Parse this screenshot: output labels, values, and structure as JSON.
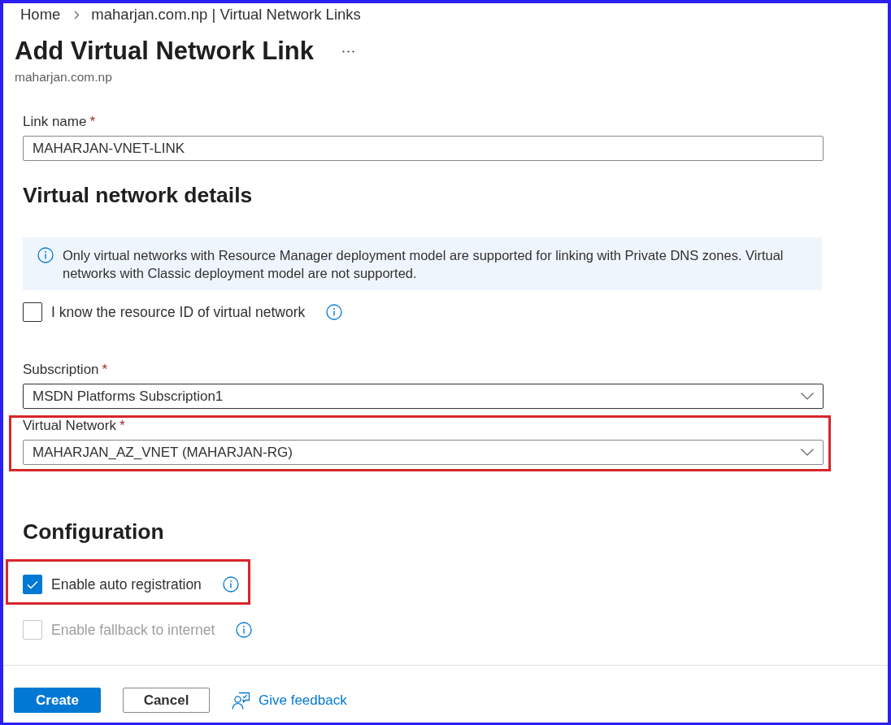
{
  "breadcrumb": [
    "Home",
    "maharjan.com.np | Virtual Network Links"
  ],
  "header": {
    "title": "Add Virtual Network Link",
    "subtitle": "maharjan.com.np"
  },
  "form": [
    {
      "kind": "text",
      "label": "Link name",
      "required_mark": "*",
      "value": "MAHARJAN-VNET-LINK",
      "hovered": false
    },
    {
      "kind": "heading",
      "text": "Virtual network details"
    },
    {
      "kind": "info",
      "text": "Only virtual networks with Resource Manager deployment model are supported for linking with Private DNS zones. Virtual networks with Classic deployment model are not supported."
    },
    {
      "kind": "checkbox",
      "label": "I know the resource ID of virtual network",
      "checked": false,
      "disabled": false
    },
    {
      "kind": "select",
      "label": "Subscription",
      "required_mark": "*",
      "value": "MSDN Platforms Subscription1",
      "hovered": true
    },
    {
      "kind": "select",
      "label": "Virtual Network",
      "required_mark": "*",
      "value": "MAHARJAN_AZ_VNET (MAHARJAN-RG)",
      "hovered": false,
      "highlighted": true
    },
    {
      "kind": "heading",
      "text": "Configuration"
    },
    {
      "kind": "checkbox",
      "label": "Enable auto registration",
      "checked": true,
      "disabled": false,
      "highlighted": true
    },
    {
      "kind": "checkbox",
      "label": "Enable fallback to internet",
      "checked": false,
      "disabled": true
    }
  ],
  "footer": {
    "buttons": [
      {
        "label": "Create",
        "kind": "primary"
      },
      {
        "label": "Cancel",
        "kind": "secondary"
      }
    ],
    "feedback_link": "Give feedback"
  }
}
